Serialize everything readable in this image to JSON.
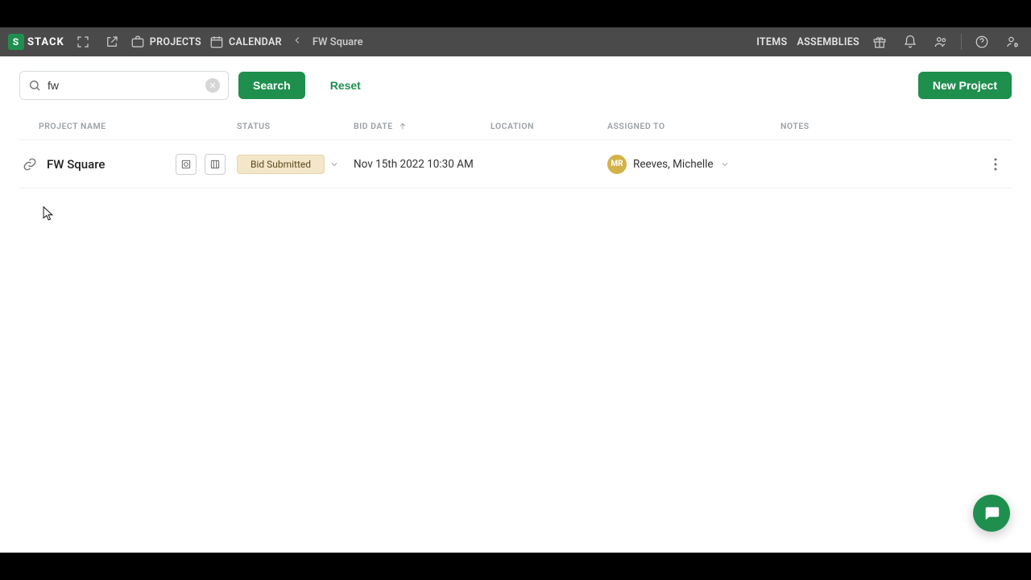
{
  "brand": {
    "logo_text": "STACK",
    "logo_initial": "S"
  },
  "nav": {
    "links": {
      "projects": "PROJECTS",
      "calendar": "CALENDAR",
      "items": "ITEMS",
      "assemblies": "ASSEMBLIES"
    },
    "breadcrumb_current": "FW Square"
  },
  "toolbar": {
    "search_value": "fw",
    "search_placeholder": "Search",
    "search_btn": "Search",
    "reset_btn": "Reset",
    "new_project_btn": "New Project"
  },
  "columns": {
    "name": "PROJECT NAME",
    "status": "STATUS",
    "bid": "BID DATE",
    "location": "LOCATION",
    "assigned": "ASSIGNED TO",
    "notes": "NOTES"
  },
  "rows": [
    {
      "name": "FW Square",
      "status": "Bid Submitted",
      "bid_date": "Nov 15th 2022 10:30 AM",
      "location": "",
      "assignee": {
        "initials": "MR",
        "name": "Reeves, Michelle"
      },
      "notes": ""
    }
  ],
  "colors": {
    "accent": "#1f8f4e",
    "navbar": "#4a4a4a",
    "status_bg": "#f3e6c9"
  }
}
